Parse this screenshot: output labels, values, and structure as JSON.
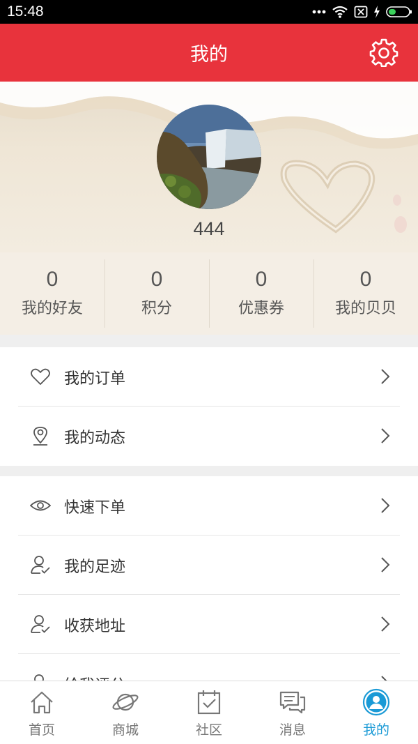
{
  "status_bar": {
    "time": "15:48"
  },
  "header": {
    "title": "我的"
  },
  "profile": {
    "username": "444"
  },
  "stats": [
    {
      "value": "0",
      "label": "我的好友"
    },
    {
      "value": "0",
      "label": "积分"
    },
    {
      "value": "0",
      "label": "优惠券"
    },
    {
      "value": "0",
      "label": "我的贝贝"
    }
  ],
  "menu_group1": [
    {
      "label": "我的订单",
      "icon": "heart-icon"
    },
    {
      "label": "我的动态",
      "icon": "location-pin-icon"
    }
  ],
  "menu_group2": [
    {
      "label": "快速下单",
      "icon": "eye-icon"
    },
    {
      "label": "我的足迹",
      "icon": "user-check-icon"
    },
    {
      "label": "收获地址",
      "icon": "user-check-icon"
    },
    {
      "label": "给我评分",
      "icon": "user-icon"
    }
  ],
  "tabs": [
    {
      "label": "首页",
      "icon": "home-icon"
    },
    {
      "label": "商城",
      "icon": "planet-icon"
    },
    {
      "label": "社区",
      "icon": "calendar-check-icon"
    },
    {
      "label": "消息",
      "icon": "chat-icon"
    },
    {
      "label": "我的",
      "icon": "user-circle-icon",
      "active": true
    }
  ],
  "colors": {
    "header": "#e8333c",
    "active_tab": "#1a9ad6"
  }
}
